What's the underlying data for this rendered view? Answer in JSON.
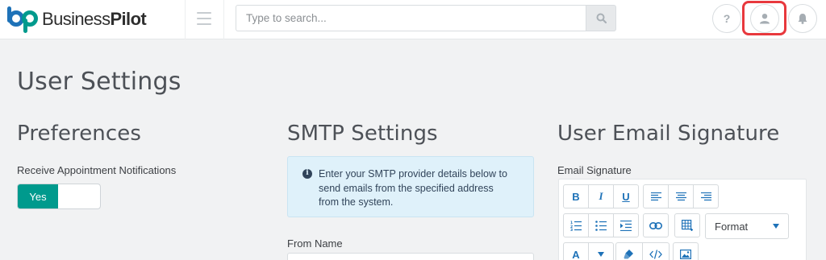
{
  "app": {
    "brand_part1": "Business",
    "brand_part2": "Pilot",
    "brand_colors": {
      "teal": "#009a8d",
      "blue": "#1e72b8"
    }
  },
  "header": {
    "search_placeholder": "Type to search...",
    "help_label": "?",
    "icons": [
      "menu-icon",
      "search-icon",
      "help-icon",
      "user-icon",
      "bell-icon"
    ],
    "highlight_color": "#e8383d"
  },
  "page": {
    "title": "User Settings"
  },
  "preferences": {
    "title": "Preferences",
    "notifications_label": "Receive Appointment Notifications",
    "toggle_value": "Yes",
    "toggle_color": "#009a8d"
  },
  "smtp": {
    "title": "SMTP Settings",
    "info_line1": "Enter your SMTP provider details below to",
    "info_line2": "send emails from the specified address",
    "info_line3": "from the system.",
    "from_name_label": "From Name"
  },
  "signature": {
    "title": "User Email Signature",
    "field_label": "Email Signature",
    "toolbar": {
      "bold": "B",
      "italic": "I",
      "underline": "U",
      "format_label": "Format",
      "font_color": "A",
      "icons": [
        "align-left-icon",
        "align-center-icon",
        "align-right-icon",
        "ordered-list-icon",
        "unordered-list-icon",
        "indent-icon",
        "link-icon",
        "table-icon",
        "dropdown-caret-icon",
        "clear-format-icon",
        "code-view-icon",
        "image-icon"
      ]
    }
  }
}
